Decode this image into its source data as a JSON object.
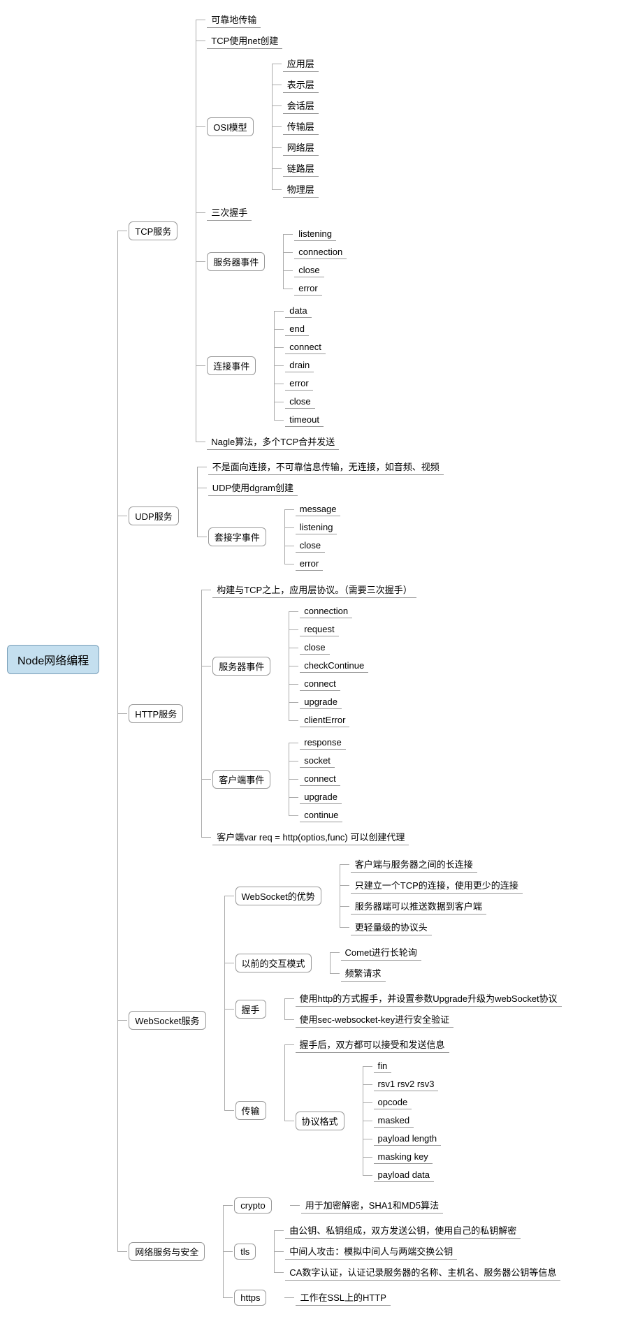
{
  "root": "Node网络编程",
  "tcp": {
    "title": "TCP服务",
    "reliable": "可靠地传输",
    "net": "TCP使用net创建",
    "osi": {
      "title": "OSI模型",
      "layers": [
        "应用层",
        "表示层",
        "会话层",
        "传输层",
        "网络层",
        "链路层",
        "物理层"
      ]
    },
    "handshake": "三次握手",
    "serverEvents": {
      "title": "服务器事件",
      "items": [
        "listening",
        "connection",
        "close",
        "error"
      ]
    },
    "connEvents": {
      "title": "连接事件",
      "items": [
        "data",
        "end",
        "connect",
        "drain",
        "error",
        "close",
        "timeout"
      ]
    },
    "nagle": "Nagle算法，多个TCP合并发送"
  },
  "udp": {
    "title": "UDP服务",
    "desc": "不是面向连接，不可靠信息传输，无连接，如音频、视频",
    "dgram": "UDP使用dgram创建",
    "socketEvents": {
      "title": "套接字事件",
      "items": [
        "message",
        "listening",
        "close",
        "error"
      ]
    }
  },
  "http": {
    "title": "HTTP服务",
    "desc": "构建与TCP之上，应用层协议。（需要三次握手）",
    "serverEvents": {
      "title": "服务器事件",
      "items": [
        "connection",
        "request",
        "close",
        "checkContinue",
        "connect",
        "upgrade",
        "clientError"
      ]
    },
    "clientEvents": {
      "title": "客户端事件",
      "items": [
        "response",
        "socket",
        "connect",
        "upgrade",
        "continue"
      ]
    },
    "proxy": "客户端var req = http(optios,func) 可以创建代理"
  },
  "ws": {
    "title": "WebSocket服务",
    "adv": {
      "title": "WebSocket的优势",
      "items": [
        "客户端与服务器之间的长连接",
        "只建立一个TCP的连接，使用更少的连接",
        "服务器端可以推送数据到客户端",
        "更轻量级的协议头"
      ]
    },
    "oldMode": {
      "title": "以前的交互模式",
      "items": [
        "Comet进行长轮询",
        "频繁请求"
      ]
    },
    "handshake": {
      "title": "握手",
      "items": [
        "使用http的方式握手，并设置参数Upgrade升级为webSocket协议",
        "使用sec-websocket-key进行安全验证"
      ]
    },
    "transfer": {
      "title": "传输",
      "afterHandshake": "握手后，双方都可以接受和发送信息",
      "format": {
        "title": "协议格式",
        "items": [
          "fin",
          "rsv1 rsv2 rsv3",
          "opcode",
          "masked",
          "payload length",
          "masking key",
          "payload data"
        ]
      }
    }
  },
  "security": {
    "title": "网络服务与安全",
    "crypto": {
      "title": "crypto",
      "desc": "用于加密解密，SHA1和MD5算法"
    },
    "tls": {
      "title": "tls",
      "items": [
        "由公钥、私钥组成，双方发送公钥，使用自己的私钥解密",
        "中间人攻击：模拟中间人与两端交换公钥",
        "CA数字认证，认证记录服务器的名称、主机名、服务器公钥等信息"
      ]
    },
    "https": {
      "title": "https",
      "desc": "工作在SSL上的HTTP"
    }
  }
}
